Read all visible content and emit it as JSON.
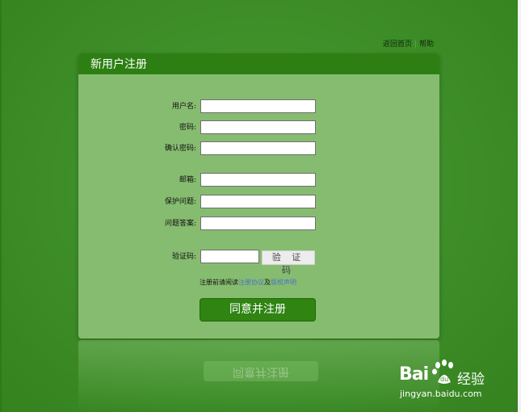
{
  "top_links": {
    "home": "返回首页",
    "separator": "|",
    "help": "帮助"
  },
  "panel": {
    "title": "新用户注册"
  },
  "form": {
    "username_label": "用户名:",
    "password_label": "密码:",
    "confirm_password_label": "确认密码:",
    "email_label": "邮箱:",
    "security_question_label": "保护问题:",
    "security_answer_label": "问题答案:",
    "captcha_label": "验证码:",
    "captcha_button": "验 证 码",
    "username_value": "",
    "password_value": "",
    "confirm_password_value": "",
    "email_value": "",
    "security_question_value": "",
    "security_answer_value": "",
    "captcha_value": ""
  },
  "agreement": {
    "prefix": "注册前请阅读",
    "terms_link": "注册协议",
    "middle": "及",
    "privacy_link": "版权声明"
  },
  "submit_label": "同意并注册",
  "watermark": {
    "brand": "Bai",
    "brand_suffix": "经验",
    "url": "jingyan.baidu.com"
  },
  "colors": {
    "background": "#3a8a26",
    "panel": "#86bc70",
    "panel_header": "#2d7f13",
    "button": "#2f8412",
    "link": "#4a73c8"
  }
}
